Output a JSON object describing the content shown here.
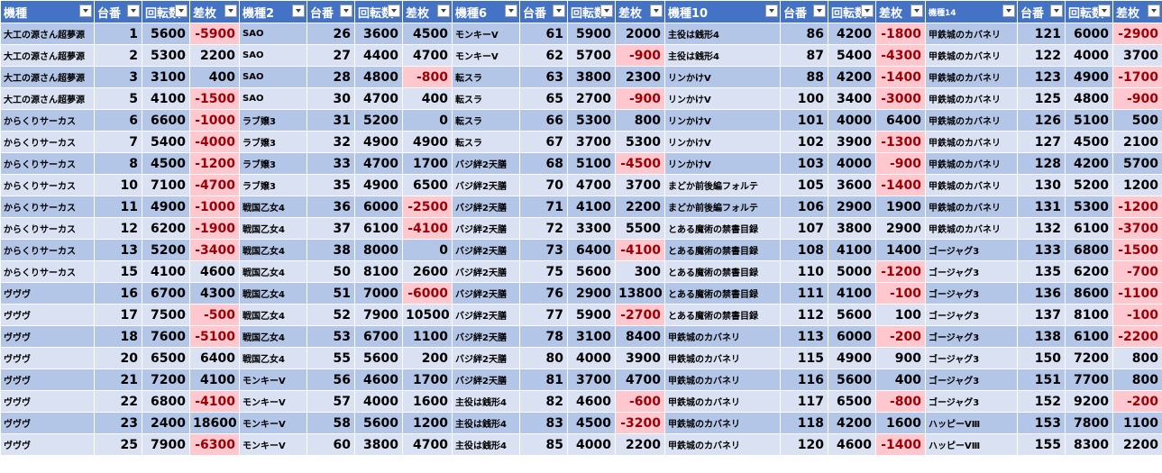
{
  "headers": [
    "機種",
    "台番",
    "回転数",
    "差枚",
    "機種2",
    "台番",
    "回転数",
    "差枚",
    "機種6",
    "台番",
    "回転数",
    "差枚",
    "機種10",
    "台番",
    "回転数",
    "差枚",
    "機種14",
    "台番",
    "回転数",
    "差枚"
  ],
  "rows": [
    [
      "大工の源さん超夢源",
      "1",
      "5600",
      "-5900",
      "SAO",
      "26",
      "3600",
      "4500",
      "モンキーV",
      "61",
      "5900",
      "2000",
      "主役は銭形4",
      "86",
      "4200",
      "-1800",
      "甲鉄城のカバネリ",
      "121",
      "6000",
      "-2900"
    ],
    [
      "大工の源さん超夢源",
      "2",
      "5300",
      "2200",
      "SAO",
      "27",
      "4400",
      "4700",
      "モンキーV",
      "62",
      "5700",
      "-900",
      "主役は銭形4",
      "87",
      "5400",
      "-4300",
      "甲鉄城のカバネリ",
      "122",
      "4000",
      "3700"
    ],
    [
      "大工の源さん超夢源",
      "3",
      "3100",
      "400",
      "SAO",
      "28",
      "4800",
      "-800",
      "転スラ",
      "63",
      "3800",
      "2300",
      "リンかけV",
      "88",
      "4200",
      "-1400",
      "甲鉄城のカバネリ",
      "123",
      "4900",
      "-1700"
    ],
    [
      "大工の源さん超夢源",
      "5",
      "4100",
      "-1500",
      "SAO",
      "30",
      "4700",
      "400",
      "転スラ",
      "65",
      "2700",
      "-900",
      "リンかけV",
      "100",
      "3400",
      "-3000",
      "甲鉄城のカバネリ",
      "125",
      "4800",
      "-900"
    ],
    [
      "からくりサーカス",
      "6",
      "6600",
      "-1000",
      "ラブ嬢3",
      "31",
      "5200",
      "0",
      "転スラ",
      "66",
      "5300",
      "800",
      "リンかけV",
      "101",
      "4000",
      "6400",
      "甲鉄城のカバネリ",
      "126",
      "5100",
      "500"
    ],
    [
      "からくりサーカス",
      "7",
      "5400",
      "-4000",
      "ラブ嬢3",
      "32",
      "4900",
      "4900",
      "転スラ",
      "67",
      "3700",
      "5300",
      "リンかけV",
      "102",
      "3900",
      "-1300",
      "甲鉄城のカバネリ",
      "127",
      "4500",
      "2100"
    ],
    [
      "からくりサーカス",
      "8",
      "4500",
      "-1200",
      "ラブ嬢3",
      "33",
      "4700",
      "1700",
      "バジ絆2天膳",
      "68",
      "5100",
      "-4500",
      "リンかけV",
      "103",
      "4000",
      "-900",
      "甲鉄城のカバネリ",
      "128",
      "4200",
      "5700"
    ],
    [
      "からくりサーカス",
      "10",
      "7100",
      "-4700",
      "ラブ嬢3",
      "35",
      "4900",
      "6500",
      "バジ絆2天膳",
      "70",
      "4700",
      "3700",
      "まどか前後編フォルテ",
      "105",
      "3600",
      "-1400",
      "甲鉄城のカバネリ",
      "130",
      "5200",
      "1200"
    ],
    [
      "からくりサーカス",
      "11",
      "4900",
      "-1000",
      "戦国乙女4",
      "36",
      "6000",
      "-2500",
      "バジ絆2天膳",
      "71",
      "4100",
      "2200",
      "まどか前後編フォルテ",
      "106",
      "2900",
      "1900",
      "甲鉄城のカバネリ",
      "131",
      "5300",
      "-1200"
    ],
    [
      "からくりサーカス",
      "12",
      "6200",
      "-1900",
      "戦国乙女4",
      "37",
      "6100",
      "-4100",
      "バジ絆2天膳",
      "72",
      "3300",
      "5500",
      "とある魔術の禁書目録",
      "107",
      "3800",
      "2900",
      "甲鉄城のカバネリ",
      "132",
      "6100",
      "-3700"
    ],
    [
      "からくりサーカス",
      "13",
      "5200",
      "-3400",
      "戦国乙女4",
      "38",
      "8000",
      "0",
      "バジ絆2天膳",
      "73",
      "6400",
      "-4100",
      "とある魔術の禁書目録",
      "108",
      "4100",
      "1400",
      "ゴージャグ3",
      "133",
      "6800",
      "-1500"
    ],
    [
      "からくりサーカス",
      "15",
      "4100",
      "4600",
      "戦国乙女4",
      "50",
      "8100",
      "2600",
      "バジ絆2天膳",
      "75",
      "5600",
      "300",
      "とある魔術の禁書目録",
      "110",
      "5000",
      "-1200",
      "ゴージャグ3",
      "135",
      "6200",
      "-700"
    ],
    [
      "ヴヴヴ",
      "16",
      "6700",
      "4300",
      "戦国乙女4",
      "51",
      "7000",
      "-6000",
      "バジ絆2天膳",
      "76",
      "2900",
      "13800",
      "とある魔術の禁書目録",
      "111",
      "4100",
      "-100",
      "ゴージャグ3",
      "136",
      "8600",
      "-1100"
    ],
    [
      "ヴヴヴ",
      "17",
      "7500",
      "-500",
      "戦国乙女4",
      "52",
      "7900",
      "10500",
      "バジ絆2天膳",
      "77",
      "5900",
      "-2700",
      "とある魔術の禁書目録",
      "112",
      "5600",
      "100",
      "ゴージャグ3",
      "137",
      "8100",
      "-100"
    ],
    [
      "ヴヴヴ",
      "18",
      "7600",
      "-5100",
      "戦国乙女4",
      "53",
      "6700",
      "1100",
      "バジ絆2天膳",
      "78",
      "3100",
      "8400",
      "甲鉄城のカバネリ",
      "113",
      "6000",
      "-200",
      "ゴージャグ3",
      "138",
      "6100",
      "-2200"
    ],
    [
      "ヴヴヴ",
      "20",
      "6500",
      "6400",
      "戦国乙女4",
      "55",
      "5600",
      "200",
      "バジ絆2天膳",
      "80",
      "4000",
      "3900",
      "甲鉄城のカバネリ",
      "115",
      "4900",
      "900",
      "ゴージャグ3",
      "150",
      "7200",
      "800"
    ],
    [
      "ヴヴヴ",
      "21",
      "7200",
      "4100",
      "モンキーV",
      "56",
      "4600",
      "1700",
      "バジ絆2天膳",
      "81",
      "3700",
      "4700",
      "甲鉄城のカバネリ",
      "116",
      "5600",
      "400",
      "ゴージャグ3",
      "151",
      "7700",
      "800"
    ],
    [
      "ヴヴヴ",
      "22",
      "6800",
      "-4100",
      "モンキーV",
      "57",
      "4000",
      "1600",
      "主役は銭形4",
      "82",
      "4600",
      "-600",
      "甲鉄城のカバネリ",
      "117",
      "6500",
      "-800",
      "ゴージャグ3",
      "152",
      "9200",
      "-200"
    ],
    [
      "ヴヴヴ",
      "23",
      "2400",
      "18600",
      "モンキーV",
      "58",
      "5600",
      "1200",
      "主役は銭形4",
      "83",
      "4500",
      "-3200",
      "甲鉄城のカバネリ",
      "118",
      "4200",
      "1600",
      "ハッピーVⅢ",
      "153",
      "7800",
      "1100"
    ],
    [
      "ヴヴヴ",
      "25",
      "7900",
      "-6300",
      "モンキーV",
      "60",
      "3800",
      "4700",
      "主役は銭形4",
      "85",
      "4000",
      "2200",
      "甲鉄城のカバネリ",
      "120",
      "4600",
      "-1400",
      "ハッピーVⅢ",
      "155",
      "8300",
      "2200"
    ]
  ],
  "colors": {
    "header_bg": "#4472c4",
    "header_text": "#ffffff",
    "row_band_dark": "#b4c6e7",
    "row_band_light": "#d9e1f2",
    "negative_bg": "#ffc7ce",
    "negative_text": "#9c0006"
  }
}
